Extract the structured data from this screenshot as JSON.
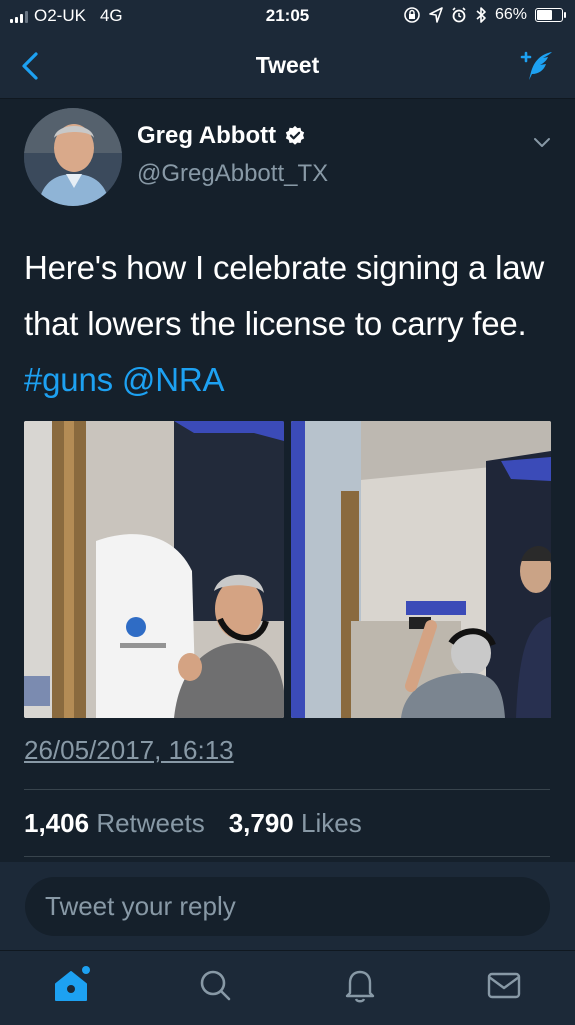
{
  "status_bar": {
    "carrier": "O2-UK",
    "network": "4G",
    "time": "21:05",
    "battery": "66%",
    "battery_level": 0.66
  },
  "nav": {
    "title": "Tweet"
  },
  "tweet": {
    "display_name": "Greg Abbott",
    "handle": "@GregAbbott_TX",
    "text_plain": "Here's how I celebrate signing a law that lowers the license to carry fee. ",
    "hashtag": "#guns",
    "mention": "@NRA",
    "timestamp": "26/05/2017, 16:13",
    "retweets_count": "1,406",
    "retweets_label": "Retweets",
    "likes_count": "3,790",
    "likes_label": "Likes"
  },
  "reply": {
    "placeholder": "Tweet your reply"
  },
  "colors": {
    "background": "#15202b",
    "bar": "#1c2938",
    "accent": "#1da1f2",
    "secondary_text": "#8899a6"
  },
  "icons": [
    "back-chevron-icon",
    "compose-tweet-icon",
    "verified-icon",
    "chevron-down-icon",
    "home-icon",
    "search-icon",
    "notifications-bell-icon",
    "messages-envelope-icon"
  ]
}
